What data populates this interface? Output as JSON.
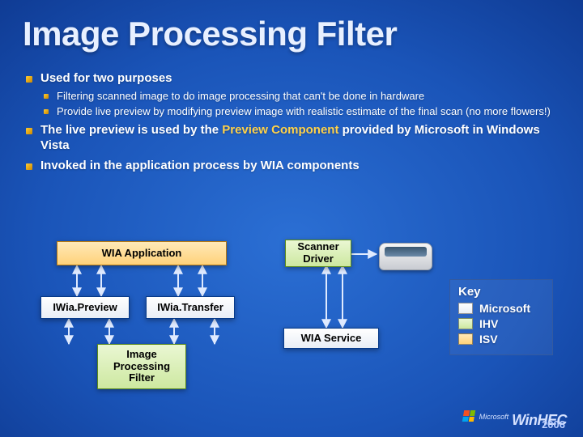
{
  "title": "Image Processing Filter",
  "bullets": {
    "b1": "Used for two purposes",
    "b1a": "Filtering scanned image to do image processing that can't be done in hardware",
    "b1b": "Provide live preview by modifying preview image with realistic estimate of the final scan (no more flowers!)",
    "b2_pre": "The live preview is used by the ",
    "b2_hl": "Preview Component",
    "b2_post": " provided by Microsoft in Windows Vista",
    "b3": "Invoked in the application process by WIA components"
  },
  "diagram": {
    "wia_app": "WIA Application",
    "scanner_driver": "Scanner\nDriver",
    "iwia_preview": "IWia.Preview",
    "iwia_transfer": "IWia.Transfer",
    "wia_service": "WIA Service",
    "ipf": "Image\nProcessing\nFilter"
  },
  "key": {
    "title": "Key",
    "microsoft": "Microsoft",
    "ihv": "IHV",
    "isv": "ISV"
  },
  "footer": {
    "company": "Microsoft",
    "brand": "WinHEC",
    "year": "2006"
  }
}
